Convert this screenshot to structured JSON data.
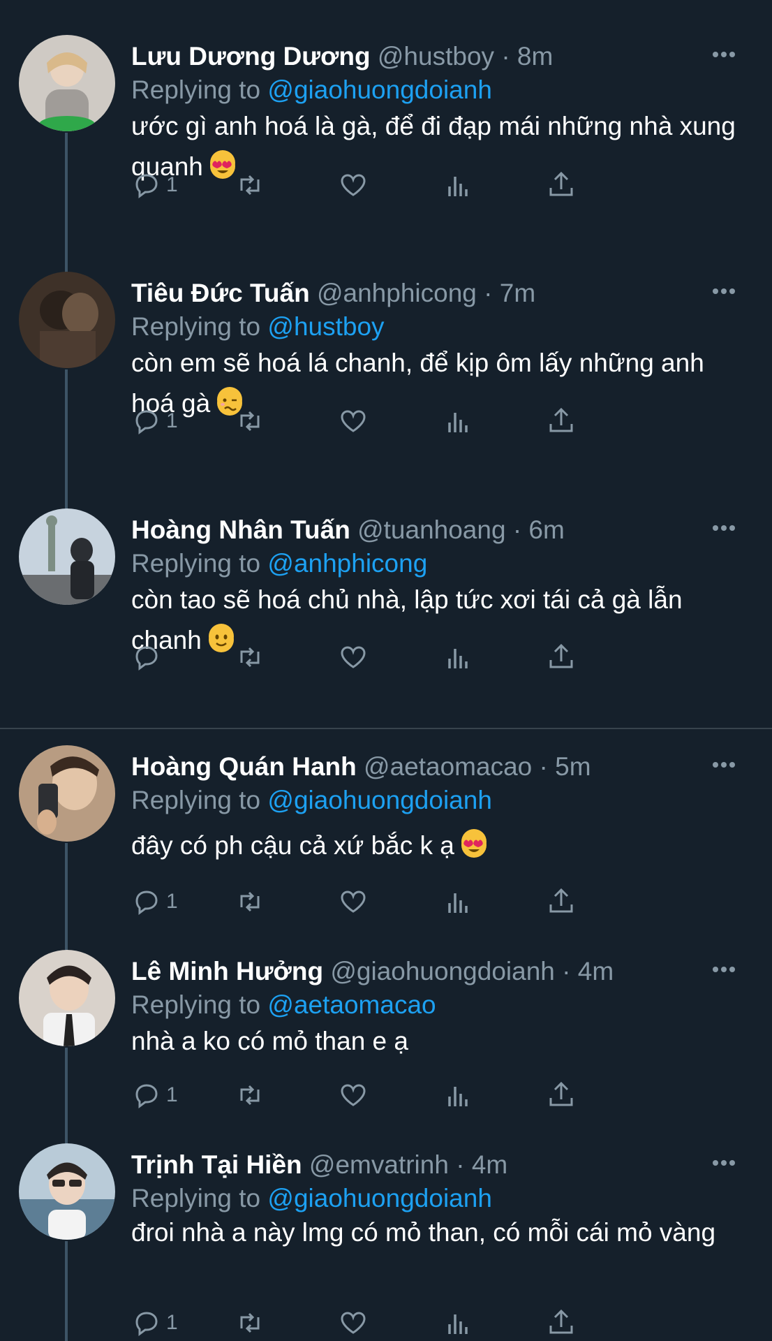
{
  "labels": {
    "replying_to": "Replying to"
  },
  "tweets": [
    {
      "name": "Lưu Dương Dương",
      "handle": "@hustboy",
      "time": "· 8m",
      "replying_to": "@giaohuongdoianh",
      "text": "ước gì anh hoá là gà, để đi đạp mái những nhà xung quanh",
      "emoji": "heart-eyes-emoji",
      "reply_count": "1",
      "avatar_color": "#c9c6c0"
    },
    {
      "name": "Tiêu Đức Tuấn",
      "handle": "@anhphicong",
      "time": "· 7m",
      "replying_to": "@hustboy",
      "text": "còn em sẽ hoá lá chanh, để kịp ôm lấy những anh hoá gà",
      "emoji": "woozy-face-emoji",
      "reply_count": "1",
      "avatar_color": "#5a4a40"
    },
    {
      "name": "Hoàng Nhân Tuấn",
      "handle": "@tuanhoang",
      "time": "· 6m",
      "replying_to": "@anhphicong",
      "text": "còn tao sẽ hoá chủ nhà, lập tức xơi tái cả gà lẫn chanh",
      "emoji": "slightly-smiling-emoji",
      "reply_count": "",
      "avatar_color": "#8fa3b8"
    },
    {
      "name": "Hoàng Quán Hanh",
      "handle": "@aetaomacao",
      "time": "· 5m",
      "replying_to": "@giaohuongdoianh",
      "text": "đây có ph cậu cả xứ bắc k ạ",
      "emoji": "heart-eyes-emoji",
      "reply_count": "1",
      "avatar_color": "#9c8570"
    },
    {
      "name": "Lê Minh Hưởng",
      "handle": "@giaohuongdoianh",
      "time": "· 4m",
      "replying_to": "@aetaomacao",
      "text": "nhà a ko có mỏ than e ạ",
      "emoji": "",
      "reply_count": "1",
      "avatar_color": "#b7aca2"
    },
    {
      "name": "Trịnh Tại Hiền",
      "handle": "@emvatrinh",
      "time": "· 4m",
      "replying_to": "@giaohuongdoianh",
      "text": "đroi nhà a này lmg có mỏ than, có mỗi cái mỏ vàng",
      "emoji": "",
      "reply_count": "1",
      "avatar_color": "#8aa5b5"
    }
  ]
}
